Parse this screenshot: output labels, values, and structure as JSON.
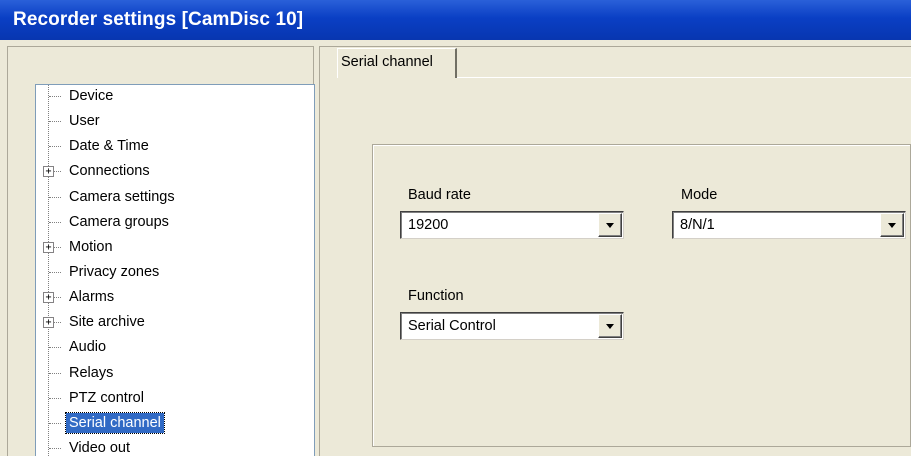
{
  "window": {
    "title": "Recorder settings [CamDisc 10]"
  },
  "tree": {
    "items": [
      {
        "label": "Device",
        "expandable": false,
        "selected": false
      },
      {
        "label": "User",
        "expandable": false,
        "selected": false
      },
      {
        "label": "Date & Time",
        "expandable": false,
        "selected": false
      },
      {
        "label": "Connections",
        "expandable": true,
        "selected": false
      },
      {
        "label": "Camera settings",
        "expandable": false,
        "selected": false
      },
      {
        "label": "Camera groups",
        "expandable": false,
        "selected": false
      },
      {
        "label": "Motion",
        "expandable": true,
        "selected": false
      },
      {
        "label": "Privacy zones",
        "expandable": false,
        "selected": false
      },
      {
        "label": "Alarms",
        "expandable": true,
        "selected": false
      },
      {
        "label": "Site archive",
        "expandable": true,
        "selected": false
      },
      {
        "label": "Audio",
        "expandable": false,
        "selected": false
      },
      {
        "label": "Relays",
        "expandable": false,
        "selected": false
      },
      {
        "label": "PTZ control",
        "expandable": false,
        "selected": false
      },
      {
        "label": "Serial channel",
        "expandable": false,
        "selected": true
      },
      {
        "label": "Video out",
        "expandable": false,
        "selected": false
      }
    ],
    "expand_glyph": "+"
  },
  "tabs": [
    {
      "label": "Serial channel",
      "active": true
    }
  ],
  "form": {
    "baud_rate": {
      "label": "Baud rate",
      "value": "19200"
    },
    "mode": {
      "label": "Mode",
      "value": "8/N/1"
    },
    "function": {
      "label": "Function",
      "value": "Serial Control"
    }
  },
  "colors": {
    "titlebar": "#0a3fc4",
    "selection": "#316ac5",
    "dialog_bg": "#ece9d8"
  }
}
